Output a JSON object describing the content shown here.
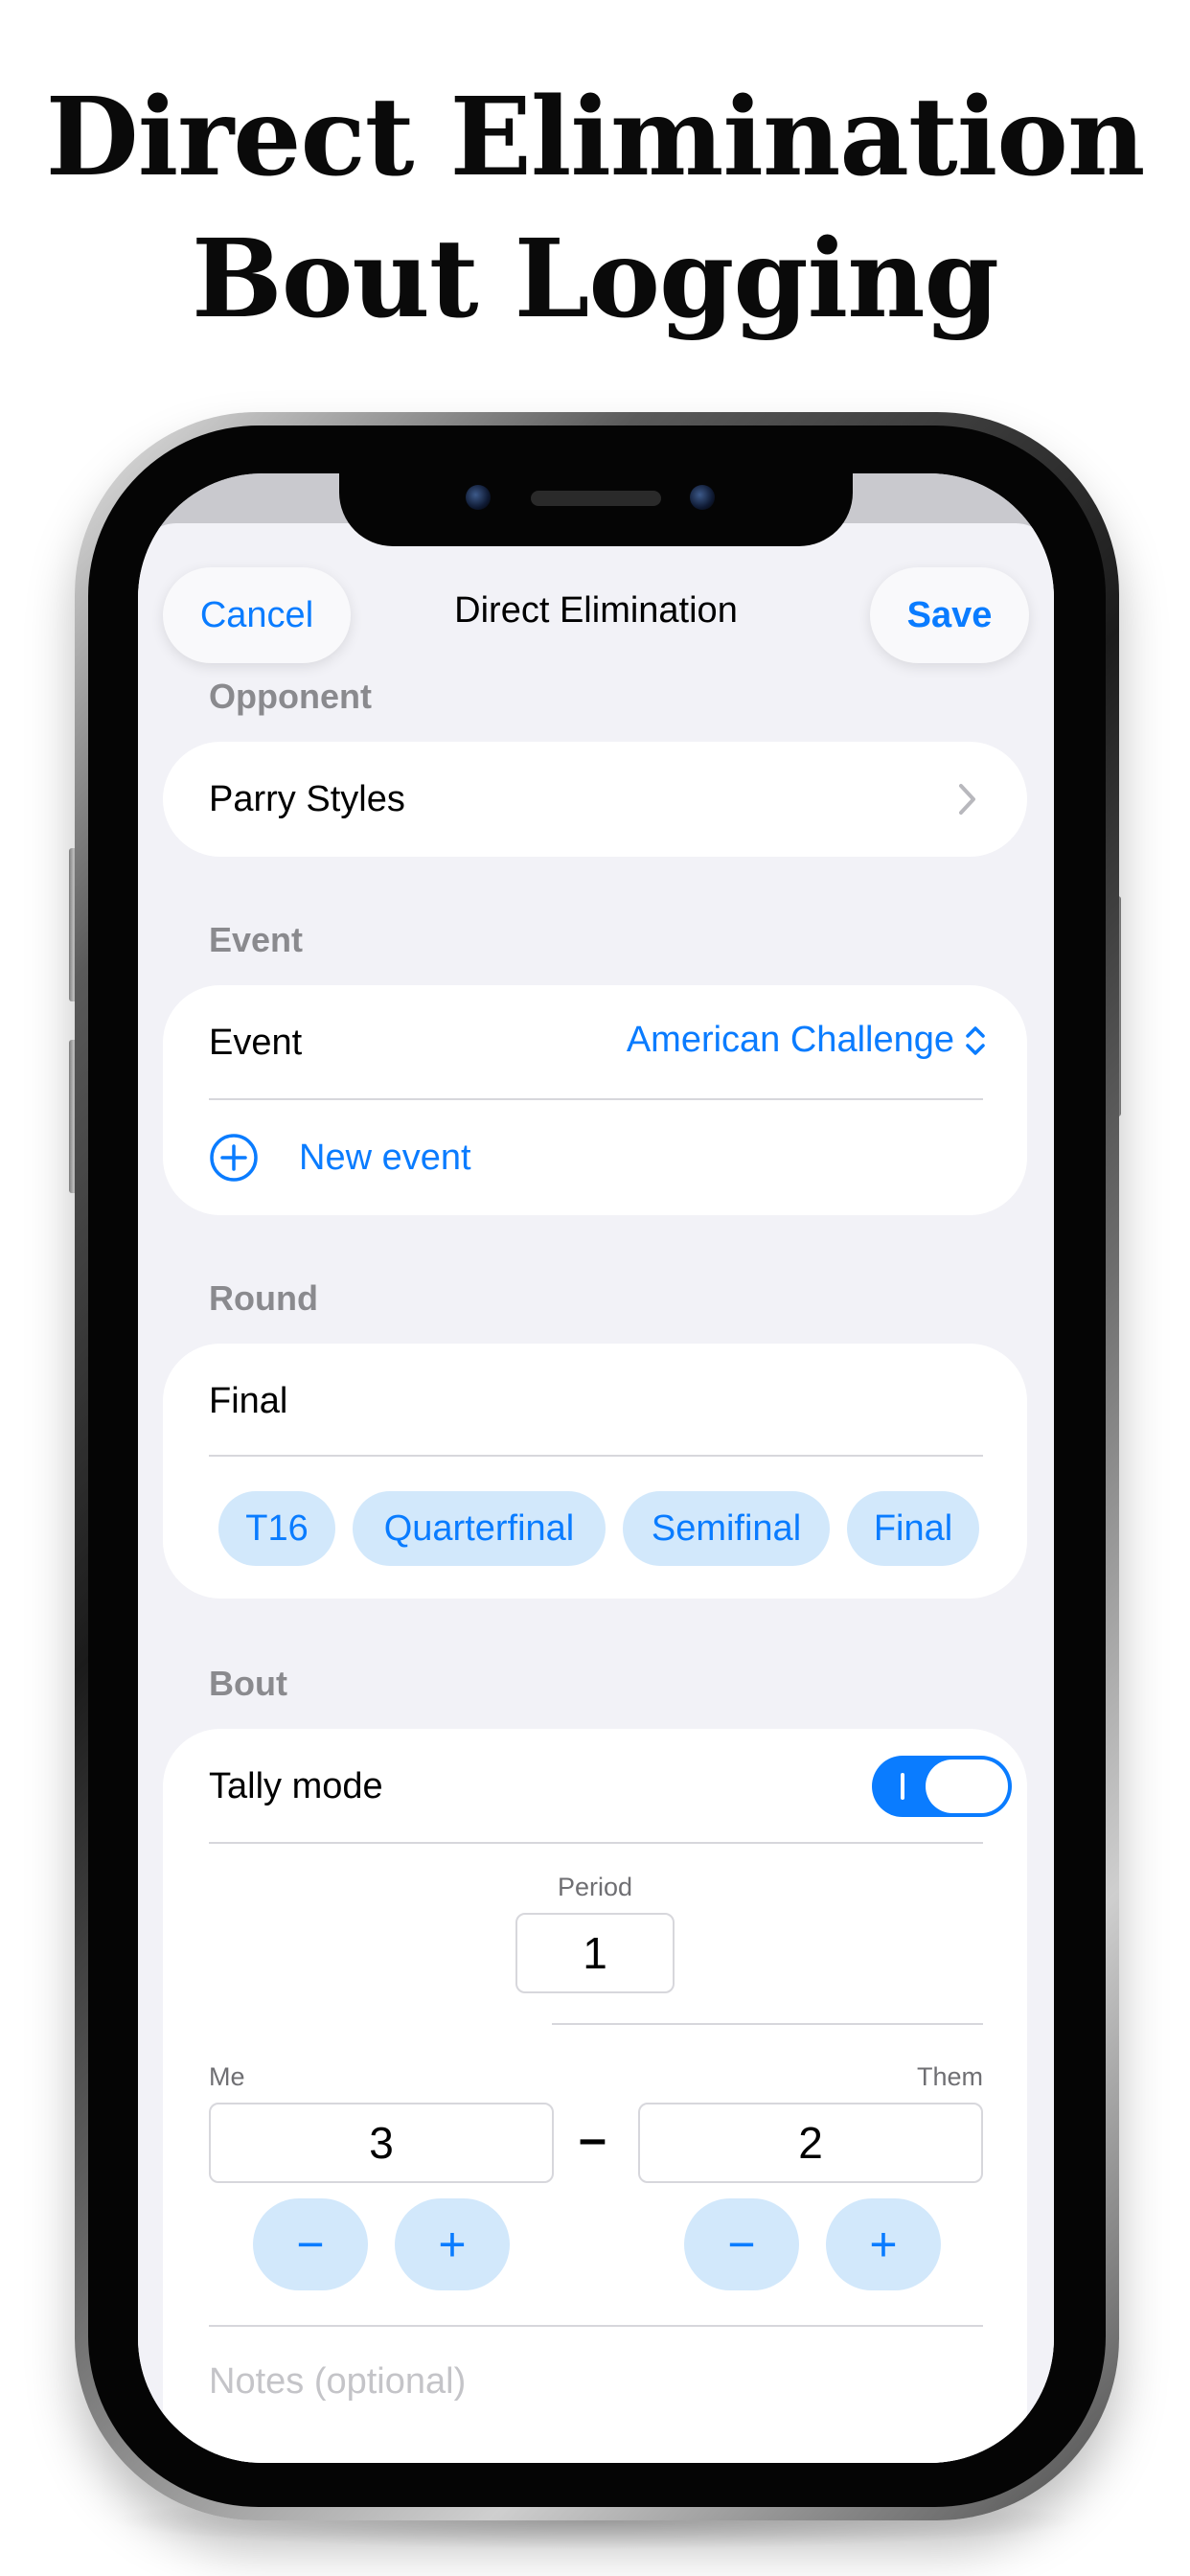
{
  "headline": {
    "line1": "Direct Elimination",
    "line2": "Bout Logging"
  },
  "nav": {
    "cancel_label": "Cancel",
    "title": "Direct Elimination",
    "save_label": "Save"
  },
  "opponent": {
    "section_label": "Opponent",
    "value": "Parry Styles",
    "icon": "chevron-right-icon"
  },
  "event": {
    "section_label": "Event",
    "row_label": "Event",
    "selected": "American Challenge",
    "selector_icon": "chevron-up-down-icon",
    "new_event_label": "New event",
    "new_event_icon": "plus-circle-icon"
  },
  "round": {
    "section_label": "Round",
    "value": "Final",
    "chips": [
      "T16",
      "Quarterfinal",
      "Semifinal",
      "Final"
    ]
  },
  "bout": {
    "section_label": "Bout",
    "tally_mode_label": "Tally mode",
    "tally_mode_on": true,
    "period_label": "Period",
    "period_value": "1",
    "me_label": "Me",
    "them_label": "Them",
    "me_score": "3",
    "them_score": "2",
    "separator": "–",
    "minus_symbol": "−",
    "plus_symbol": "+"
  },
  "notes": {
    "placeholder": "Notes (optional)"
  },
  "colors": {
    "accent": "#0a7cff",
    "chip_bg": "#d2e8fb",
    "background": "#f2f2f7",
    "toggle_on": "#0a7cff"
  }
}
